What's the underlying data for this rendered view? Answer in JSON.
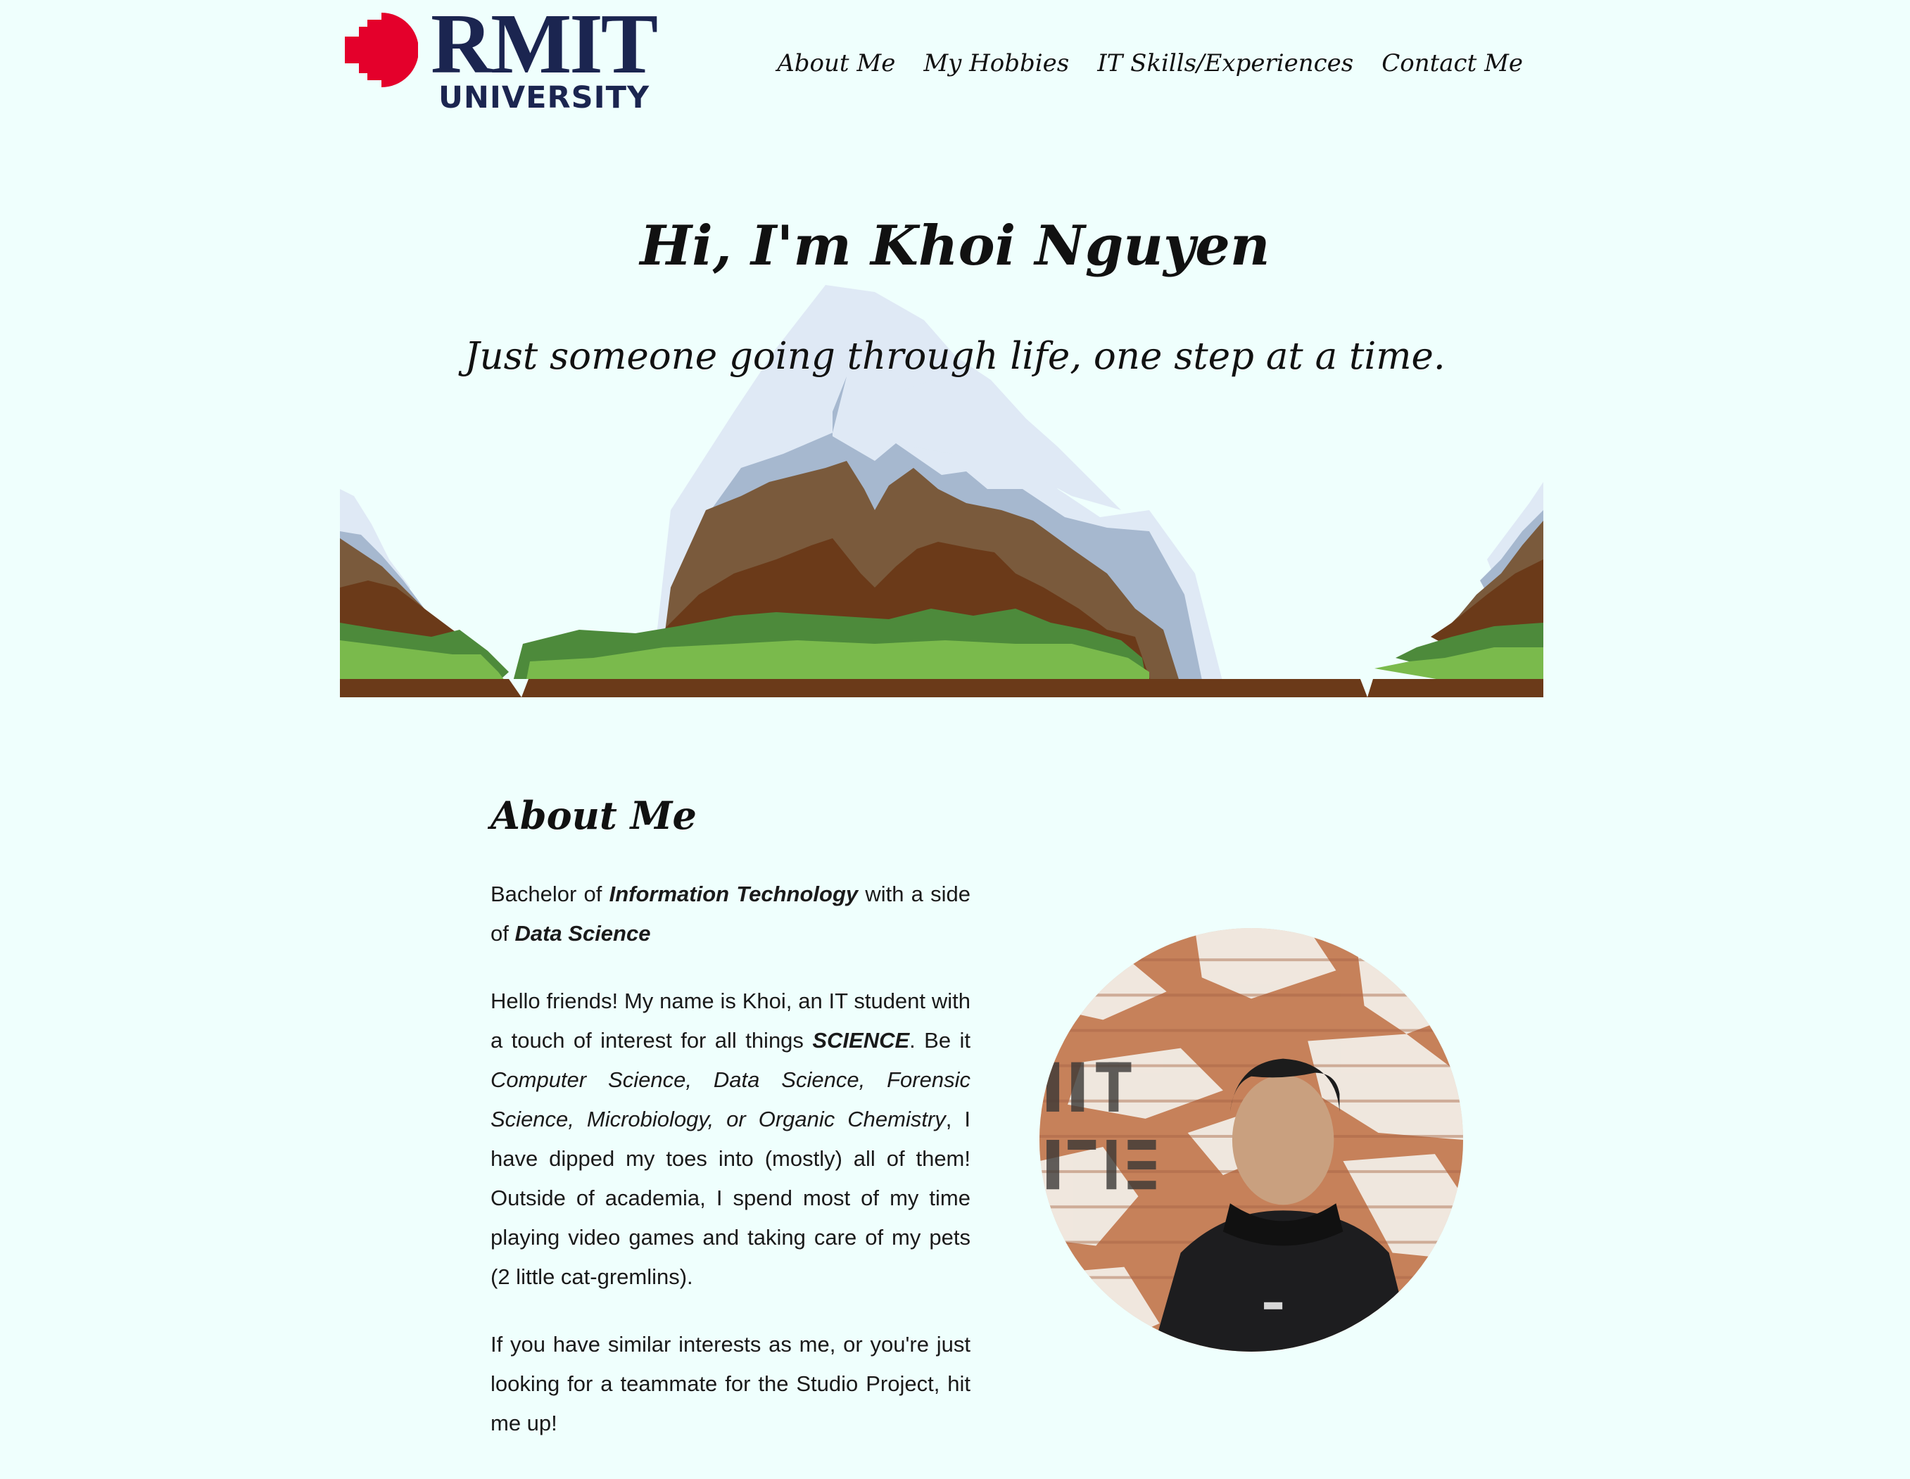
{
  "logo": {
    "line1": "RMIT",
    "line2": "UNIVERSITY",
    "mark_color": "#e4002b",
    "text_color": "#1b2550"
  },
  "nav": {
    "items": [
      {
        "label": "About Me"
      },
      {
        "label": "My Hobbies"
      },
      {
        "label": "IT Skills/Experiences"
      },
      {
        "label": "Contact Me"
      }
    ]
  },
  "hero": {
    "title": "Hi, I'm Khoi Nguyen",
    "subtitle": "Just someone going through life, one step at a time.",
    "image": "mountain-illustration"
  },
  "about": {
    "heading": "About Me",
    "degree_prefix": "Bachelor of ",
    "degree_major": "Information Technology",
    "degree_mid": " with a side of ",
    "degree_minor": "Data Science",
    "p2_a": "Hello friends! My name is Khoi, an IT student with a touch of interest for all things ",
    "p2_science": "SCIENCE",
    "p2_b": ". Be it ",
    "p2_fields": "Computer Science, Data Science, Forensic Science, Microbiology, or Organic Chemistry",
    "p2_c": ", I have dipped my toes into (mostly) all of them! Outside of academia, I spend most of my time playing video games and taking care of my pets (2 little cat-gremlins).",
    "p3": "If you have similar interests as me, or you're just looking for a teammate for the Studio Project, hit me up!",
    "photo": "profile-photo"
  },
  "colors": {
    "background": "#effffd",
    "snow": "#dfe9f5",
    "snow_shadow": "#a6b8cf",
    "rock_light": "#7a5a3c",
    "rock_dark": "#6b3a19",
    "grass_dark": "#4d8a3b",
    "grass_light": "#7aba4c"
  }
}
